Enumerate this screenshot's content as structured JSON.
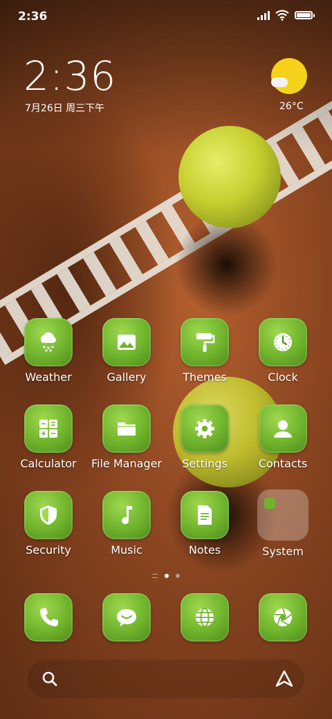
{
  "status_bar": {
    "time": "2:36"
  },
  "clock_widget": {
    "time": "2:36",
    "date": "7月26日 周三下午",
    "temperature": "26°C"
  },
  "apps_row1": [
    {
      "name": "Weather",
      "icon": "cloud-snow-icon"
    },
    {
      "name": "Gallery",
      "icon": "image-icon"
    },
    {
      "name": "Themes",
      "icon": "paint-roller-icon"
    },
    {
      "name": "Clock",
      "icon": "clock-icon"
    }
  ],
  "apps_row2": [
    {
      "name": "Calculator",
      "icon": "calculator-icon"
    },
    {
      "name": "File Manager",
      "icon": "folder-icon"
    },
    {
      "name": "Settings",
      "icon": "gear-icon"
    },
    {
      "name": "Contacts",
      "icon": "person-icon"
    }
  ],
  "apps_row3": [
    {
      "name": "Security",
      "icon": "shield-icon"
    },
    {
      "name": "Music",
      "icon": "music-note-icon"
    },
    {
      "name": "Notes",
      "icon": "note-icon"
    },
    {
      "name": "System",
      "icon": "folder-icon"
    }
  ],
  "dock": [
    {
      "icon": "phone-icon"
    },
    {
      "icon": "chat-icon"
    },
    {
      "icon": "globe-icon"
    },
    {
      "icon": "camera-aperture-icon"
    }
  ],
  "pager": {
    "pages": 2,
    "current": 1
  },
  "colors": {
    "tile_green": "#6fb32c",
    "sun": "#f6d21a",
    "clay": "#8a4520"
  }
}
